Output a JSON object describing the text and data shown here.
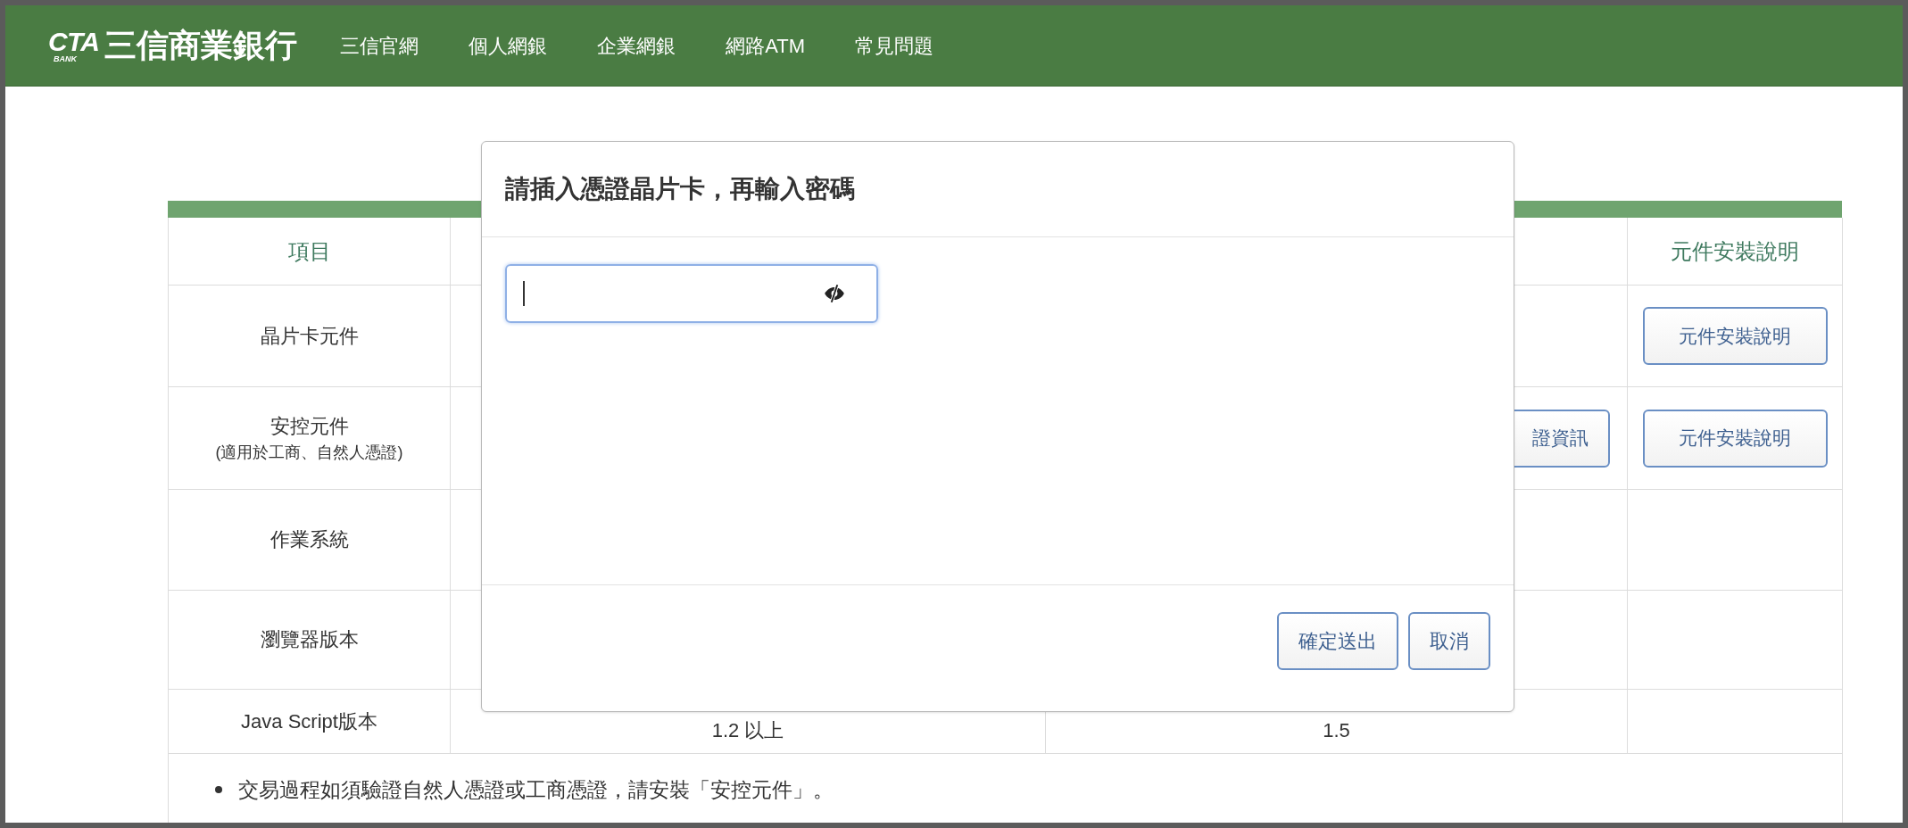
{
  "header": {
    "logo": {
      "mark": "CTA",
      "sub": "BANK",
      "name": "三信商業銀行"
    },
    "nav": [
      {
        "label": "三信官網"
      },
      {
        "label": "個人網銀"
      },
      {
        "label": "企業網銀"
      },
      {
        "label": "網路ATM"
      },
      {
        "label": "常見問題"
      }
    ]
  },
  "table": {
    "columns": [
      {
        "label": "項目"
      },
      {
        "label": "元件安裝說明"
      }
    ],
    "rows": [
      {
        "label": "晶片卡元件",
        "cells": [],
        "install_button": "元件安裝說明"
      },
      {
        "label": "安控元件",
        "sublabel": "(適用於工商、自然人憑證)",
        "cells": [],
        "info_button": "證資訊",
        "install_button": "元件安裝說明"
      },
      {
        "label": "作業系統",
        "cells": []
      },
      {
        "label": "瀏覽器版本",
        "cells": []
      },
      {
        "label": "Java Script版本",
        "cells": [
          "1.2 以上",
          "1.5"
        ]
      }
    ],
    "notes": [
      "交易過程如須驗證自然人憑證或工商憑證，請安裝「安控元件」。"
    ]
  },
  "dialog": {
    "title": "請插入憑證晶片卡，再輸入密碼",
    "password": {
      "focused": true
    },
    "buttons": [
      {
        "label": "確定送出"
      },
      {
        "label": "取消"
      }
    ]
  }
}
